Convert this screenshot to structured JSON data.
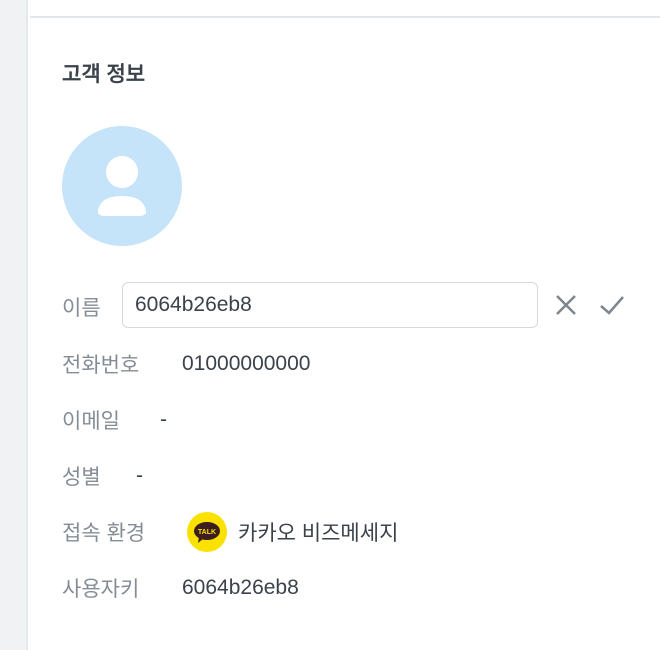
{
  "section_title": "고객 정보",
  "fields": {
    "name": {
      "label": "이름",
      "value": "6064b26eb8"
    },
    "phone": {
      "label": "전화번호",
      "value": "01000000000"
    },
    "email": {
      "label": "이메일",
      "value": "-"
    },
    "gender": {
      "label": "성별",
      "value": "-"
    },
    "channel": {
      "label": "접속 환경",
      "value": "카카오 비즈메세지",
      "icon_text": "TALK"
    },
    "user_key": {
      "label": "사용자키",
      "value": "6064b26eb8"
    }
  },
  "colors": {
    "avatar_bg": "#c5e3f9",
    "kakao_yellow": "#fae100"
  }
}
